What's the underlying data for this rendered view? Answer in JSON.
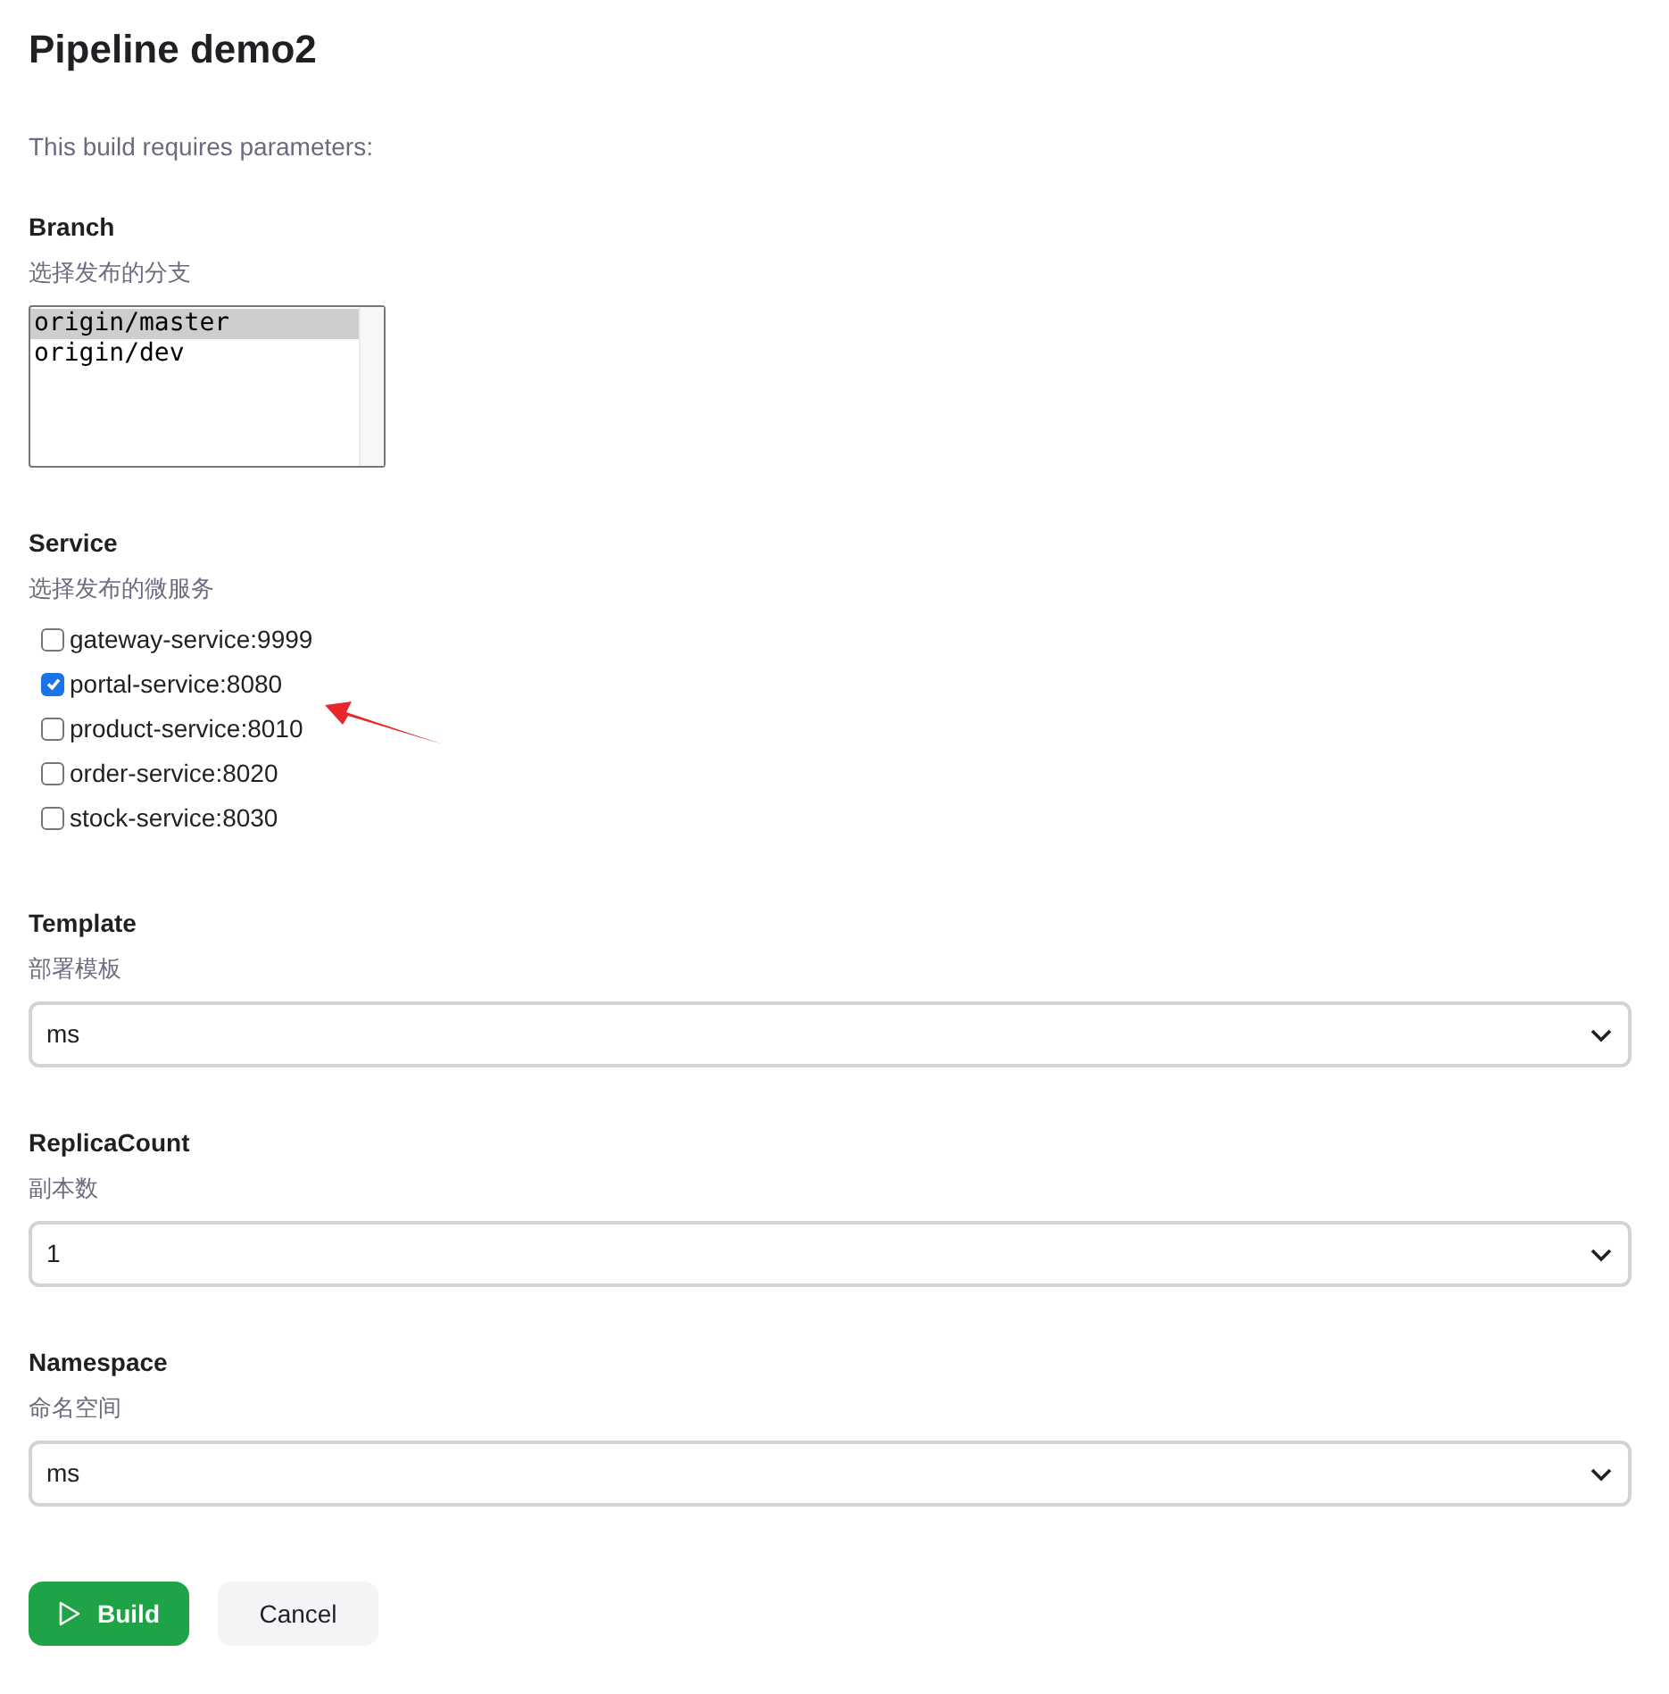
{
  "title": "Pipeline demo2",
  "description": "This build requires parameters:",
  "parameters": [
    {
      "kind": "listbox",
      "name": "Branch",
      "hint": "选择发布的分支",
      "options": [
        {
          "label": "origin/master",
          "selected": true
        },
        {
          "label": "origin/dev",
          "selected": false
        }
      ]
    },
    {
      "kind": "checkboxes",
      "name": "Service",
      "hint": "选择发布的微服务",
      "options": [
        {
          "label": "gateway-service:9999",
          "checked": false
        },
        {
          "label": "portal-service:8080",
          "checked": true
        },
        {
          "label": "product-service:8010",
          "checked": false
        },
        {
          "label": "order-service:8020",
          "checked": false
        },
        {
          "label": "stock-service:8030",
          "checked": false
        }
      ]
    },
    {
      "kind": "select",
      "name": "Template",
      "hint": "部署模板",
      "value": "ms"
    },
    {
      "kind": "select",
      "name": "ReplicaCount",
      "hint": "副本数",
      "value": "1"
    },
    {
      "kind": "select",
      "name": "Namespace",
      "hint": "命名空间",
      "value": "ms"
    }
  ],
  "buttons": [
    {
      "kind": "primary",
      "label": "Build"
    },
    {
      "kind": "secondary",
      "label": "Cancel"
    }
  ]
}
